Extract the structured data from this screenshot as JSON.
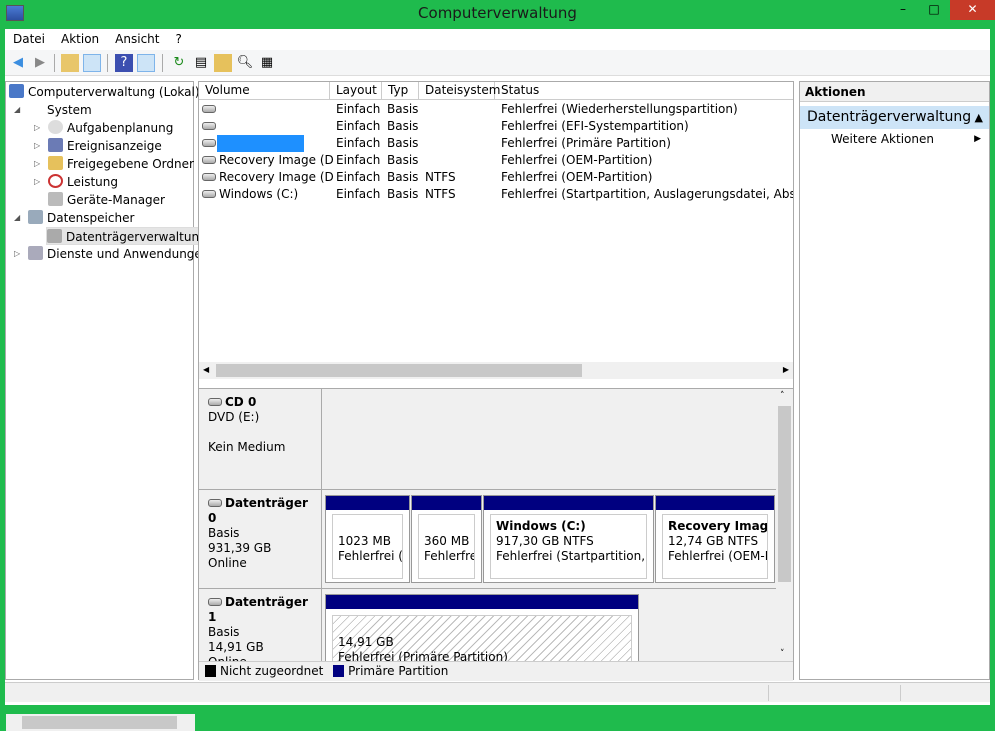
{
  "window": {
    "title": "Computerverwaltung",
    "minimize": "–",
    "maximize": "□",
    "close": "✕"
  },
  "menu": [
    "Datei",
    "Aktion",
    "Ansicht",
    "?"
  ],
  "toolbar": {
    "back": "◀",
    "forward": "▶"
  },
  "tree": {
    "items": [
      {
        "label": "Computerverwaltung (Lokal)"
      },
      {
        "label": "System"
      },
      {
        "label": "Aufgabenplanung"
      },
      {
        "label": "Ereignisanzeige"
      },
      {
        "label": "Freigegebene Ordner"
      },
      {
        "label": "Leistung"
      },
      {
        "label": "Geräte-Manager"
      },
      {
        "label": "Datenspeicher"
      },
      {
        "label": "Datenträgerverwaltung"
      },
      {
        "label": "Dienste und Anwendungen"
      }
    ]
  },
  "volumes": {
    "columns": [
      "Volume",
      "Layout",
      "Typ",
      "Dateisystem",
      "Status"
    ],
    "rows": [
      {
        "volume": "",
        "layout": "Einfach",
        "typ": "Basis",
        "fs": "",
        "status": "Fehlerfrei (Wiederherstellungspartition)"
      },
      {
        "volume": "",
        "layout": "Einfach",
        "typ": "Basis",
        "fs": "",
        "status": "Fehlerfrei (EFI-Systempartition)"
      },
      {
        "volume": "",
        "layout": "Einfach",
        "typ": "Basis",
        "fs": "",
        "status": "Fehlerfrei (Primäre Partition)"
      },
      {
        "volume": "Recovery Image (D:)",
        "layout": "Einfach",
        "typ": "Basis",
        "fs": "",
        "status": "Fehlerfrei (OEM-Partition)"
      },
      {
        "volume": "Recovery Image (D:)",
        "layout": "Einfach",
        "typ": "Basis",
        "fs": "NTFS",
        "status": "Fehlerfrei (OEM-Partition)"
      },
      {
        "volume": "Windows (C:)",
        "layout": "Einfach",
        "typ": "Basis",
        "fs": "NTFS",
        "status": "Fehlerfrei (Startpartition, Auslagerungsdatei, Absturzabbild)"
      }
    ]
  },
  "disks": {
    "cd0": {
      "name": "CD 0",
      "type": "DVD (E:)",
      "state": "Kein Medium"
    },
    "d0": {
      "name": "Datenträger 0",
      "type": "Basis",
      "size": "931,39 GB",
      "state": "Online",
      "parts": [
        {
          "title": "",
          "size": "1023 MB",
          "status": "Fehlerfrei (Wiederherstellungspartition)"
        },
        {
          "title": "",
          "size": "360 MB",
          "status": "Fehlerfrei (EFI-Systempartition)"
        },
        {
          "title": "Windows  (C:)",
          "size": "917,30 GB NTFS",
          "status": "Fehlerfrei (Startpartition, Auslagerungsdatei, Absturzabbild)"
        },
        {
          "title": "Recovery Image  (D:)",
          "size": "12,74 GB NTFS",
          "status": "Fehlerfrei (OEM-Partition)"
        }
      ]
    },
    "d1": {
      "name": "Datenträger 1",
      "type": "Basis",
      "size": "14,91 GB",
      "state": "Online",
      "parts": [
        {
          "size": "14,91 GB",
          "status": "Fehlerfrei (Primäre Partition)"
        }
      ]
    }
  },
  "legend": [
    {
      "label": "Nicht zugeordnet",
      "color": "#000000"
    },
    {
      "label": "Primäre Partition",
      "color": "#000080"
    }
  ],
  "actions": {
    "title": "Aktionen",
    "section": "Datenträgerverwaltung",
    "more": "Weitere Aktionen"
  },
  "colors": {
    "titlebar": "#1fbb4d",
    "primary_partition": "#000080",
    "selection": "#cde4f7",
    "redaction": "#1e90ff"
  }
}
